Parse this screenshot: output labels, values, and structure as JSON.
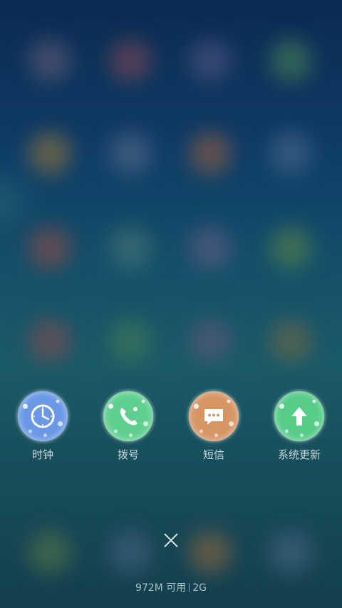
{
  "recent_apps": [
    {
      "label": "时钟",
      "icon": "clock-icon",
      "color": "#6a97e6"
    },
    {
      "label": "拨号",
      "icon": "phone-icon",
      "color": "#5fcf8f"
    },
    {
      "label": "短信",
      "icon": "message-icon",
      "color": "#d69563"
    },
    {
      "label": "系统更新",
      "icon": "update-arrow-icon",
      "color": "#55cc88"
    }
  ],
  "close_icon": "close-icon",
  "memory": {
    "available": "972M 可用",
    "total": "2G"
  }
}
